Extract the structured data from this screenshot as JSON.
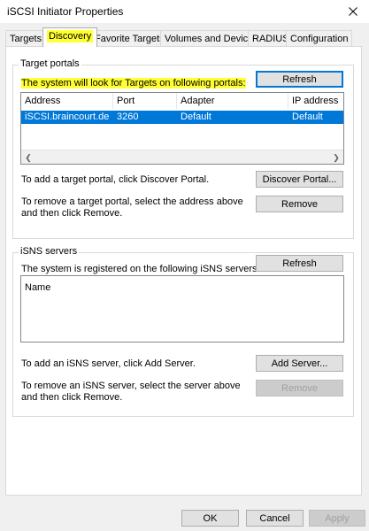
{
  "window": {
    "title": "iSCSI Initiator Properties"
  },
  "tabs": [
    {
      "label": "Targets"
    },
    {
      "label": "Discovery"
    },
    {
      "label": "Favorite Targets"
    },
    {
      "label": "Volumes and Devices"
    },
    {
      "label": "RADIUS"
    },
    {
      "label": "Configuration"
    }
  ],
  "target_portals": {
    "group_title": "Target portals",
    "description": "The system will look for Targets on following portals:",
    "refresh_label": "Refresh",
    "columns": [
      "Address",
      "Port",
      "Adapter",
      "IP address"
    ],
    "rows": [
      {
        "address": "iSCSI.braincourt.de",
        "port": "3260",
        "adapter": "Default",
        "ip": "Default"
      }
    ],
    "add_hint": "To add a target portal, click Discover Portal.",
    "discover_label": "Discover Portal...",
    "remove_hint": "To remove a target portal, select the address above and then click Remove.",
    "remove_label": "Remove"
  },
  "isns": {
    "group_title": "iSNS servers",
    "description": "The system is registered on the following iSNS servers:",
    "refresh_label": "Refresh",
    "column": "Name",
    "add_hint": "To add an iSNS server, click Add Server.",
    "add_label": "Add Server...",
    "remove_hint": "To remove an iSNS server, select the server above and then click Remove.",
    "remove_label": "Remove"
  },
  "footer": {
    "ok_label": "OK",
    "cancel_label": "Cancel",
    "apply_label": "Apply"
  },
  "colors": {
    "highlight": "#ffff33",
    "selection": "#0078d7",
    "accent_border": "#0078d7"
  }
}
